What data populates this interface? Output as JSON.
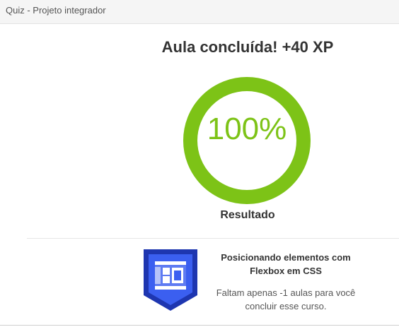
{
  "header": {
    "title": "Quiz - Projeto integrador"
  },
  "completion": {
    "headline": "Aula concluída! +40 XP",
    "percent_text": "100%",
    "progress": 1.0,
    "result_label": "Resultado",
    "ring_color": "#7dc317"
  },
  "course": {
    "title": "Posicionando elementos com Flexbox em CSS",
    "remaining_text": "Faltam apenas -1 aulas para você concluir esse curso.",
    "badge_color": "#2f4fd8",
    "badge_icon": "flexbox-layout-icon"
  },
  "colors": {
    "accent": "#7dc317",
    "badge_dark": "#1e36b0",
    "badge_light": "#3b5ff0"
  }
}
